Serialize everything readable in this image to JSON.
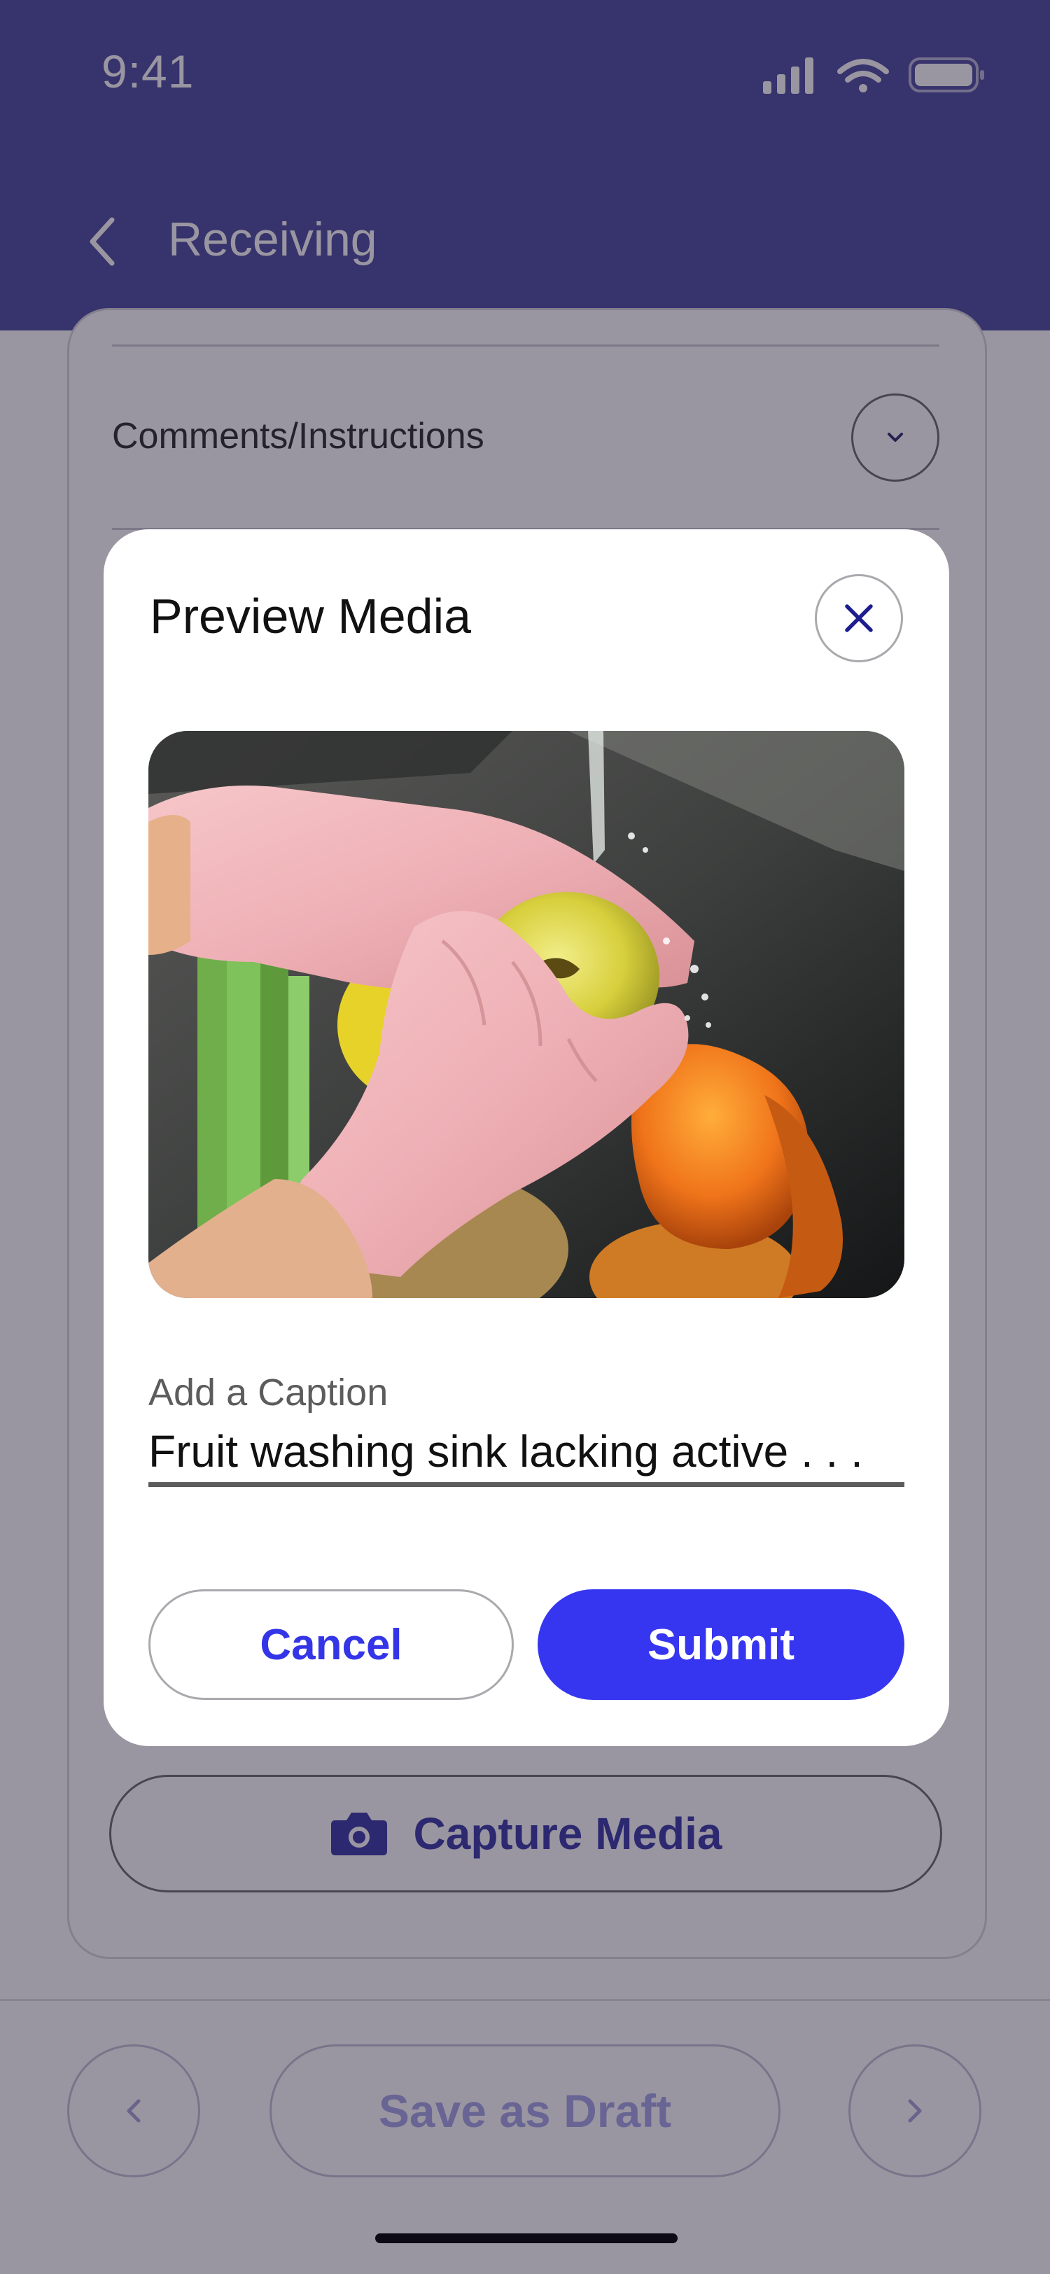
{
  "status_bar": {
    "time": "9:41"
  },
  "header": {
    "title": "Receiving"
  },
  "form": {
    "comments_label": "Comments/Instructions"
  },
  "capture": {
    "label": "Capture Media"
  },
  "footer": {
    "draft_label": "Save as Draft"
  },
  "modal": {
    "title": "Preview Media",
    "caption_label": "Add a Caption",
    "caption_value": "Fruit washing sink lacking active . . .",
    "cancel_label": "Cancel",
    "submit_label": "Submit"
  },
  "colors": {
    "header": "#4b4b9f",
    "primary": "#3636f0",
    "accent_text": "#3535e8",
    "disabled_text": "#a5a5e8"
  }
}
